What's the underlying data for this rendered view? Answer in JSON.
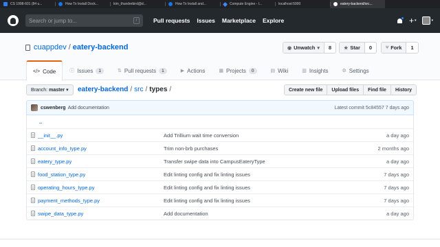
{
  "browser": {
    "tabs": [
      {
        "title": "CS 1998-601 (84 u...",
        "favicon": "p",
        "active": false
      },
      {
        "title": "How To Install Dock...",
        "favicon": "ms",
        "active": false
      },
      {
        "title": "kim_thunderbird@d...",
        "favicon": "none",
        "active": false
      },
      {
        "title": "How To Install and...",
        "favicon": "ms",
        "active": false
      },
      {
        "title": "Compute Engine - l...",
        "favicon": "gce",
        "active": false
      },
      {
        "title": "localhost:5000",
        "favicon": "none",
        "active": false
      },
      {
        "title": "eatery-backend/src...",
        "favicon": "gh",
        "active": true
      }
    ]
  },
  "header": {
    "search_placeholder": "Search or jump to...",
    "search_key": "/",
    "nav": [
      "Pull requests",
      "Issues",
      "Marketplace",
      "Explore"
    ],
    "plus": "+",
    "caret": "▾"
  },
  "repo": {
    "owner": "cuappdev",
    "separator": "/",
    "name": "eatery-backend",
    "watch_label": "Unwatch",
    "watch_caret": "▾",
    "watch_count": "8",
    "star_label": "Star",
    "star_count": "0",
    "fork_label": "Fork",
    "fork_count": "1"
  },
  "tabs": [
    {
      "label": "Code",
      "icon": "code-icon",
      "glyph": "</>",
      "counter": ""
    },
    {
      "label": "Issues",
      "icon": "issue-icon",
      "glyph": "ⓘ",
      "counter": "1"
    },
    {
      "label": "Pull requests",
      "icon": "pull-request-icon",
      "glyph": "⇅",
      "counter": "1"
    },
    {
      "label": "Actions",
      "icon": "actions-icon",
      "glyph": "▶",
      "counter": ""
    },
    {
      "label": "Projects",
      "icon": "projects-icon",
      "glyph": "▦",
      "counter": "0"
    },
    {
      "label": "Wiki",
      "icon": "wiki-icon",
      "glyph": "▤",
      "counter": ""
    },
    {
      "label": "Insights",
      "icon": "insights-icon",
      "glyph": "▥",
      "counter": ""
    },
    {
      "label": "Settings",
      "icon": "settings-icon",
      "glyph": "⚙",
      "counter": ""
    }
  ],
  "file_nav": {
    "branch_prefix": "Branch:",
    "branch": "master",
    "branch_caret": "▾",
    "path_root": "eatery-backend",
    "path_sep1": "/",
    "path_dir": "src",
    "path_sep2": "/",
    "path_current": "types",
    "path_sep3": "/",
    "buttons": [
      "Create new file",
      "Upload files",
      "Find file",
      "History"
    ]
  },
  "commit": {
    "author": "cswenberg",
    "message": "Add documentation",
    "latest": "Latest commit 5c84557 7 days ago"
  },
  "files": {
    "parent": "..",
    "rows": [
      {
        "name": "__init__.py",
        "message": "Add Trillium wait time conversion",
        "age": "a day ago"
      },
      {
        "name": "account_info_type.py",
        "message": "Trim non-brb purchases",
        "age": "2 months ago"
      },
      {
        "name": "eatery_type.py",
        "message": "Transfer swipe data into CampusEateryType",
        "age": "a day ago"
      },
      {
        "name": "food_station_type.py",
        "message": "Edit linting config and fix linting issues",
        "age": "7 days ago"
      },
      {
        "name": "operating_hours_type.py",
        "message": "Edit linting config and fix linting issues",
        "age": "7 days ago"
      },
      {
        "name": "payment_methods_type.py",
        "message": "Edit linting config and fix linting issues",
        "age": "7 days ago"
      },
      {
        "name": "swipe_data_type.py",
        "message": "Add documentation",
        "age": "a day ago"
      }
    ]
  }
}
